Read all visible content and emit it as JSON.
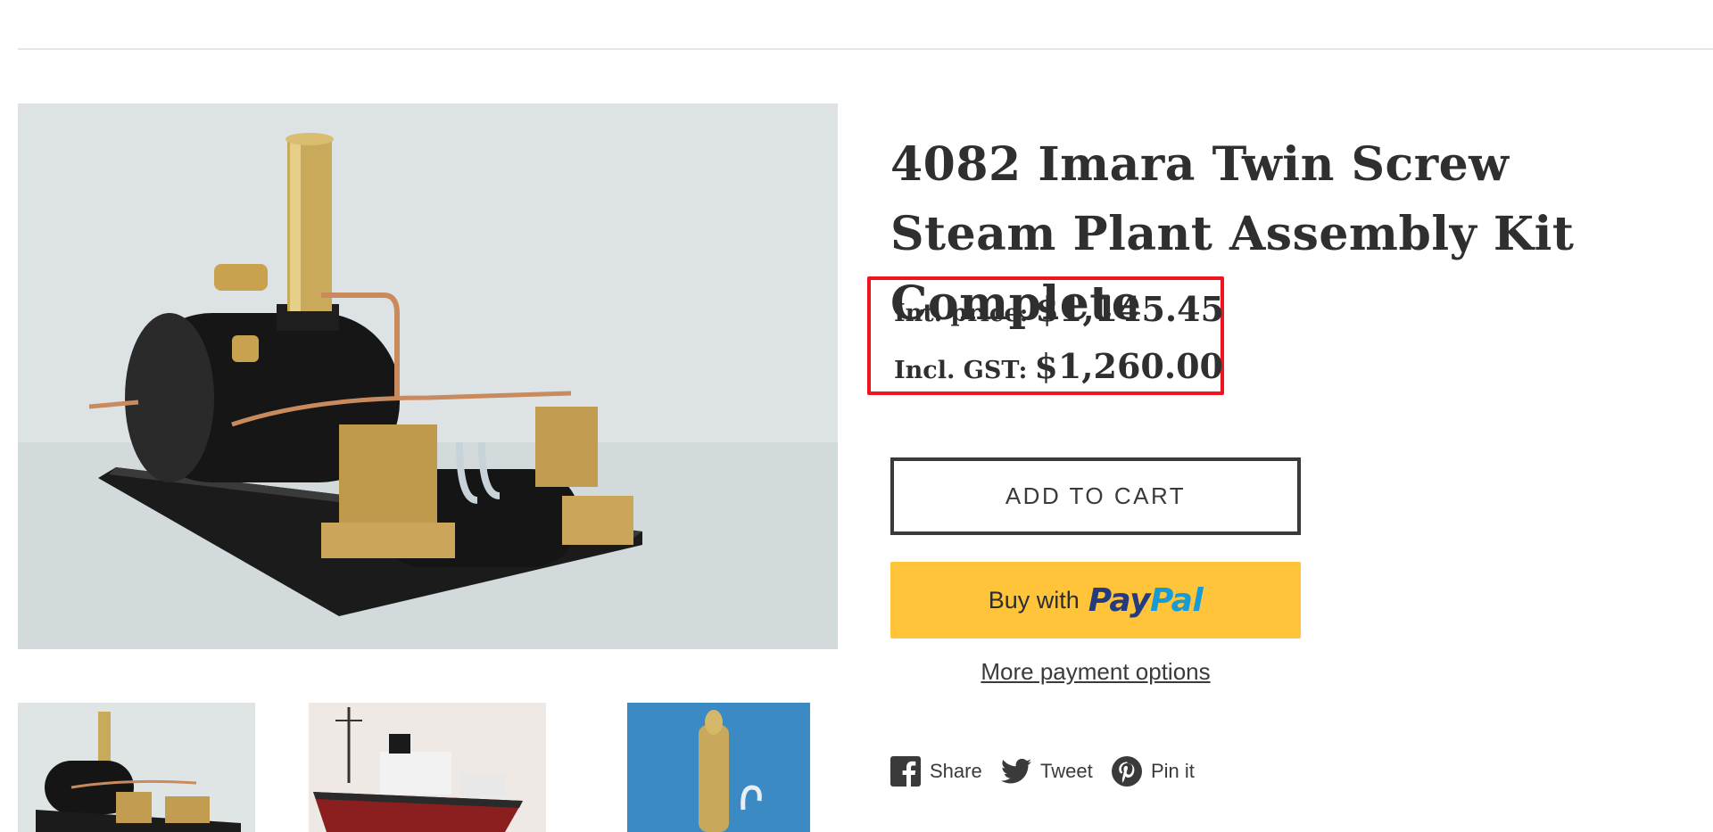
{
  "product": {
    "title": "4082 Imara Twin Screw Steam Plant Assembly Kit Complete",
    "int_price_label": "Int. price:",
    "int_price_value": "$1,145.45",
    "gst_price_label": "Incl. GST:",
    "gst_price_value": "$1,260.00"
  },
  "actions": {
    "add_to_cart": "ADD TO CART",
    "paypal_prefix": "Buy with",
    "paypal_pay": "Pay",
    "paypal_pal": "Pal",
    "more_payment": "More payment options"
  },
  "social": {
    "share": "Share",
    "tweet": "Tweet",
    "pin": "Pin it"
  },
  "colors": {
    "highlight_border": "#f0141e",
    "paypal_yellow": "#ffc439",
    "paypal_dark_blue": "#253b80",
    "paypal_light_blue": "#179bd7",
    "text": "#3a3a3a"
  },
  "icons": [
    "facebook-icon",
    "twitter-icon",
    "pinterest-icon"
  ]
}
